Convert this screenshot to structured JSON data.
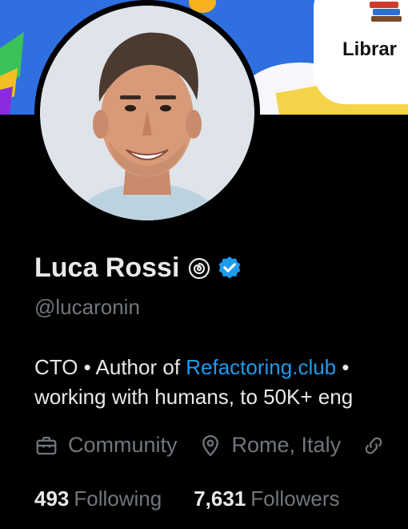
{
  "banner": {
    "card_label": "Librar"
  },
  "profile": {
    "name": "Luca Rossi",
    "handle": "@lucaronin",
    "bio_line1_prefix": "CTO • Author of ",
    "bio_link": "Refactoring.club",
    "bio_line1_suffix": " •",
    "bio_line2": "working with humans, to 50K+ eng",
    "category": "Community",
    "location": "Rome, Italy",
    "following_count": "493",
    "following_label": "Following",
    "followers_count": "7,631",
    "followers_label": "Followers"
  },
  "colors": {
    "background": "#000000",
    "primary_text": "#e7e9ea",
    "secondary_text": "#71767b",
    "link": "#1d9bf0",
    "verified": "#1d9bf0"
  }
}
